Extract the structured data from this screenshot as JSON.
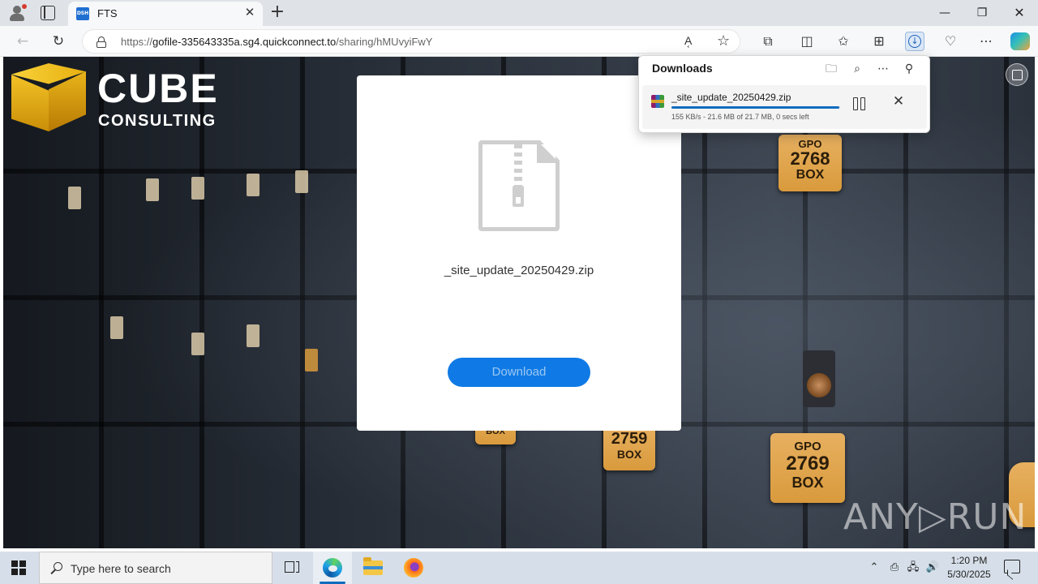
{
  "browser": {
    "tab_title": "FTS",
    "tab_favicon_text": "DSH",
    "url_prefix": "https://",
    "url_host": "gofile-335643335a.sg4.quickconnect.to",
    "url_path": "/sharing/hMUvyiFwY",
    "read_aloud_glyph": "A͔",
    "icons": {
      "profile": "profile-icon",
      "tab_actions": "tab-actions-icon",
      "new_tab": "plus-icon",
      "back": "back-arrow-icon",
      "refresh": "refresh-icon",
      "lock": "lock-icon",
      "favorite": "star-icon",
      "extensions": "puzzle-icon",
      "split_screen": "split-screen-icon",
      "favorites": "favorites-icon",
      "collections": "collections-icon",
      "downloads": "download-icon",
      "browser_essentials": "heart-pulse-icon",
      "more": "ellipsis-icon",
      "copilot": "copilot-icon"
    }
  },
  "page": {
    "logo_word": "CUBE",
    "logo_subword": "CONSULTING",
    "file_name": "_site_update_20250429.zip",
    "download_button": "Download",
    "watermark": "ANY▷RUN",
    "plates": [
      {
        "top": "GPO",
        "number": "2768",
        "bottom": "BOX"
      },
      {
        "top": "",
        "number": "2759",
        "bottom": "BOX"
      },
      {
        "top": "GPO",
        "number": "2769",
        "bottom": "BOX"
      },
      {
        "top": "",
        "number": "",
        "bottom": "BOX"
      }
    ]
  },
  "downloads_panel": {
    "title": "Downloads",
    "item": {
      "file_name": "_site_update_20250429.zip",
      "status": "155 KB/s - 21.6 MB of 21.7 MB, 0 secs left",
      "progress_fraction": 0.995
    }
  },
  "taskbar": {
    "search_placeholder": "Type here to search",
    "time": "1:20 PM",
    "date": "5/30/2025"
  },
  "colors": {
    "accent_blue": "#0f7ae5",
    "download_button_text": "#9cc7f2",
    "plate_gold": "#e0a650"
  }
}
